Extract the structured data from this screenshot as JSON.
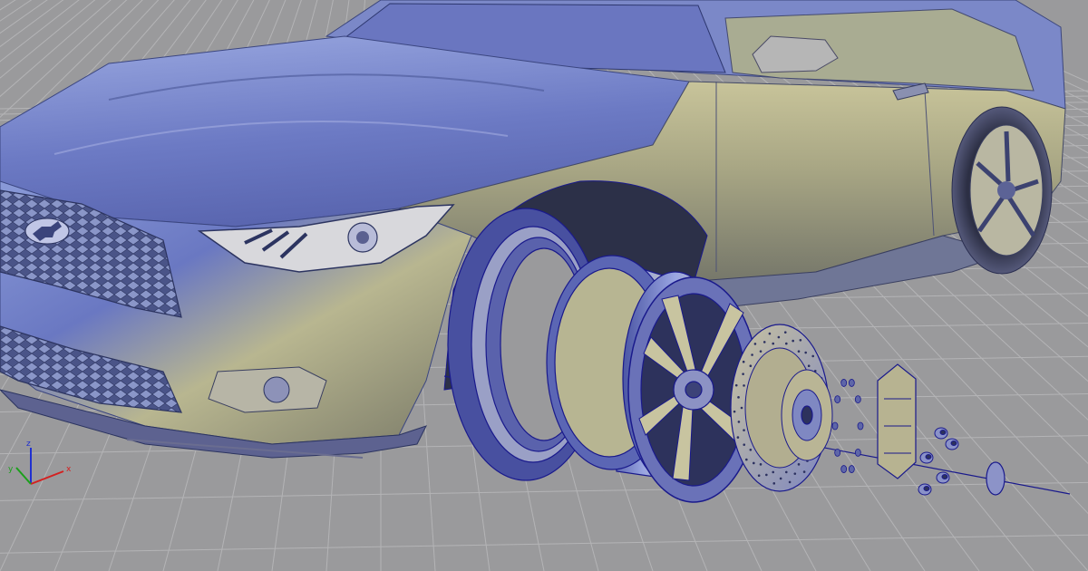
{
  "viewport": {
    "background": "#9a9a9c",
    "grid_visible": true,
    "grid_color": "#b4b4b6"
  },
  "axis_triad": {
    "x_label": "x",
    "y_label": "y",
    "z_label": "z",
    "x_color": "#d42020",
    "y_color": "#1aa01a",
    "z_color": "#2030d0"
  },
  "colors": {
    "wireframe_edge": "#1a1a8c",
    "surface_blue": "#6a7fc8",
    "surface_gold": "#c6c08e",
    "surface_dark": "#3a4470"
  },
  "icons": {
    "hub_badge": "horse-emblem-icon"
  }
}
